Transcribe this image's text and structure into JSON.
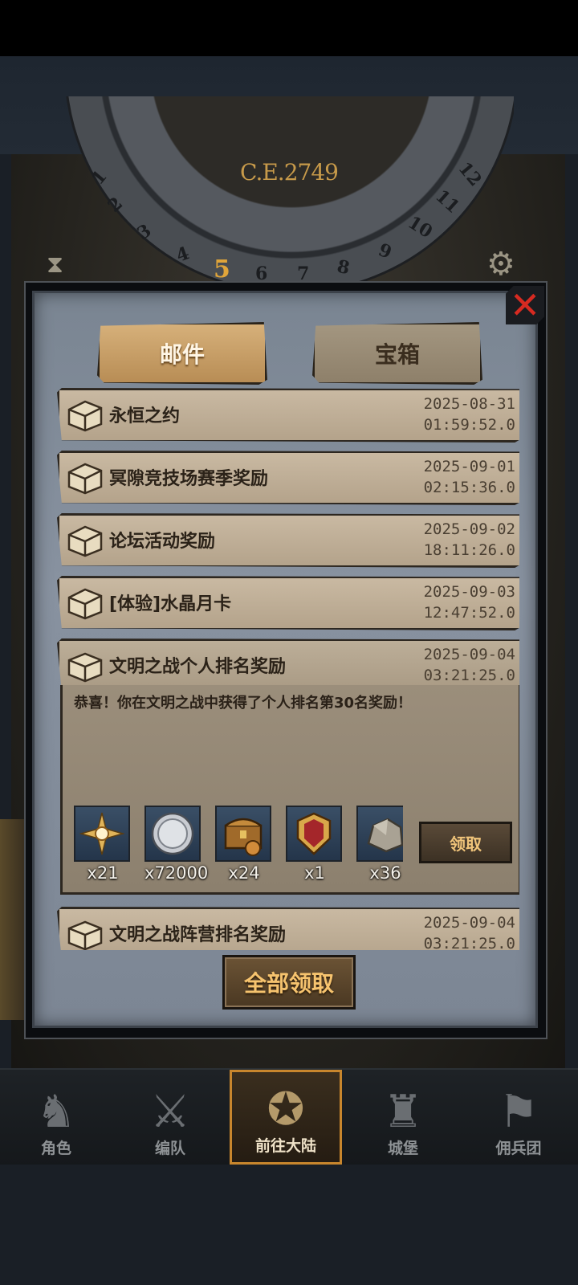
{
  "dial": {
    "year": "C.E.2749",
    "numbers": [
      "1",
      "2",
      "3",
      "4",
      "5",
      "6",
      "7",
      "8",
      "9",
      "10",
      "11",
      "12"
    ],
    "current": "5"
  },
  "tabs": {
    "mail": "邮件",
    "chest": "宝箱"
  },
  "mails": [
    {
      "title": "永恒之约",
      "date": "2025-08-31",
      "time": "01:59:52.0"
    },
    {
      "title": "冥隙竞技场赛季奖励",
      "date": "2025-09-01",
      "time": "02:15:36.0"
    },
    {
      "title": "论坛活动奖励",
      "date": "2025-09-02",
      "time": "18:11:26.0"
    },
    {
      "title": "[体验]水晶月卡",
      "date": "2025-09-03",
      "time": "12:47:52.0"
    },
    {
      "title": "文明之战个人排名奖励",
      "date": "2025-09-04",
      "time": "03:21:25.0"
    },
    {
      "title": "文明之战阵营排名奖励",
      "date": "2025-09-04",
      "time": "03:21:25.0"
    }
  ],
  "open_mail": {
    "body": "恭喜！你在文明之战中获得了个人排名第30名奖励！",
    "rewards": [
      {
        "icon": "star-medal-icon",
        "count": "x21"
      },
      {
        "icon": "silver-coin-icon",
        "count": "x72000"
      },
      {
        "icon": "treasure-chest-icon",
        "count": "x24"
      },
      {
        "icon": "banner-shield-icon",
        "count": "x1"
      },
      {
        "icon": "stone-ore-icon",
        "count": "x36"
      }
    ],
    "claim_label": "领取"
  },
  "claim_all_label": "全部领取",
  "nav": [
    {
      "label": "角色",
      "icon": "knight-icon"
    },
    {
      "label": "编队",
      "icon": "squad-icon"
    },
    {
      "label": "前往大陆",
      "icon": "compass-icon"
    },
    {
      "label": "城堡",
      "icon": "castle-icon"
    },
    {
      "label": "佣兵团",
      "icon": "mercenary-icon"
    }
  ]
}
